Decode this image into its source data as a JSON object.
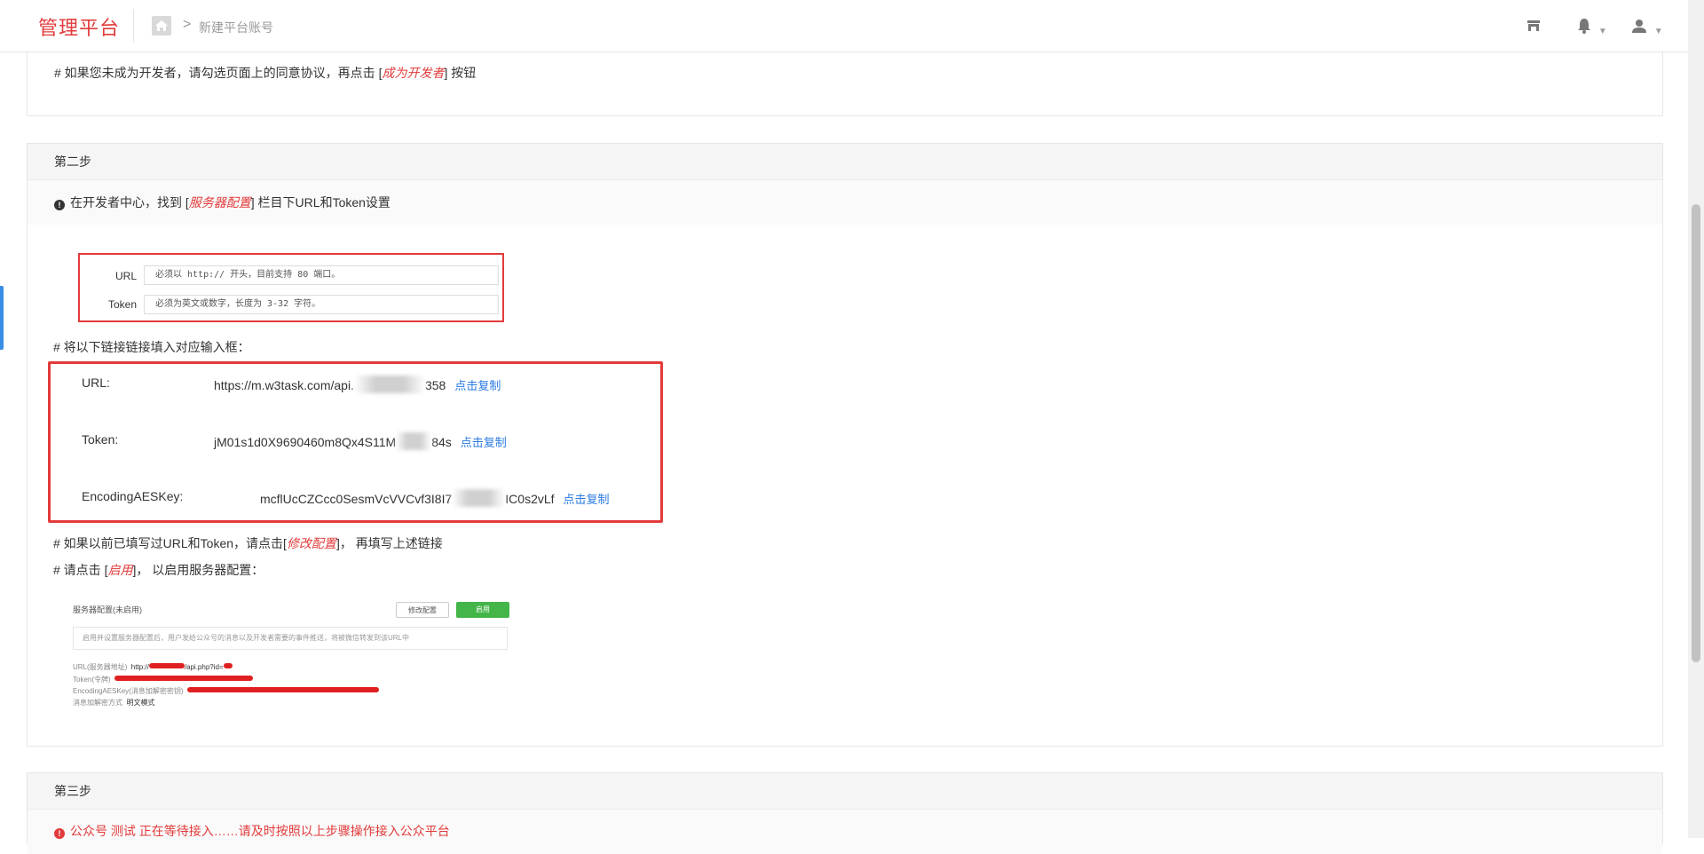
{
  "header": {
    "brand": "管理平台",
    "breadcrumb": "新建平台账号"
  },
  "step1": {
    "note_prefix": "# 如果您未成为开发者，请勾选页面上的同意协议，再点击 [",
    "note_em": "成为开发者",
    "note_suffix": "] 按钮"
  },
  "step2": {
    "title": "第二步",
    "sub_prefix": "在开发者中心，找到 [",
    "sub_em": "服务器配置",
    "sub_suffix": "] 栏目下URL和Token设置",
    "image1": {
      "url_label": "URL",
      "url_placeholder": "必须以 http:// 开头，目前支持 80 端口。",
      "token_label": "Token",
      "token_placeholder": "必须为英文或数字，长度为 3-32 字符。"
    },
    "fill_note": "# 将以下链接链接填入对应输入框：",
    "links": {
      "url_label": "URL:",
      "url_value_a": "https://m.w3task.com/api.",
      "url_value_b": "358",
      "token_label": "Token:",
      "token_value_a": "jM01s1d0X9690460m8Qx4S11M",
      "token_value_b": "84s",
      "aes_label": "EncodingAESKey:",
      "aes_value_a": "mcflUcCZCcc0SesmVcVVCvf3I8I7",
      "aes_value_b": "IC0s2vLf",
      "copy_label": "点击复制"
    },
    "modify_prefix": "# 如果以前已填写过URL和Token，请点击[",
    "modify_em": "修改配置",
    "modify_suffix": "]， 再填写上述链接",
    "enable_prefix": "# 请点击 [",
    "enable_em": "启用",
    "enable_suffix": "]， 以启用服务器配置：",
    "image2": {
      "title": "服务器配置(未启用)",
      "modify_btn": "修改配置",
      "enable_btn": "启用",
      "desc": "启用并设置服务器配置后，用户发给公众号的消息以及开发者需要的事件推送，将被微信转发到该URL中",
      "url_label": "URL(服务器地址)",
      "url_value_a": "http://",
      "url_value_b": "/api.php?id=",
      "token_label": "Token(令牌)",
      "aes_label": "EncodingAESKey(消息加解密密钥)",
      "mode_label": "消息加解密方式",
      "mode_value": "明文模式"
    }
  },
  "step3": {
    "title": "第三步",
    "status": "公众号 测试 正在等待接入……请及时按照以上步骤操作接入公众平台"
  },
  "colors": {
    "brand_red": "#e23b3b",
    "link_blue": "#2a7ae2",
    "enable_green": "#44b549"
  }
}
